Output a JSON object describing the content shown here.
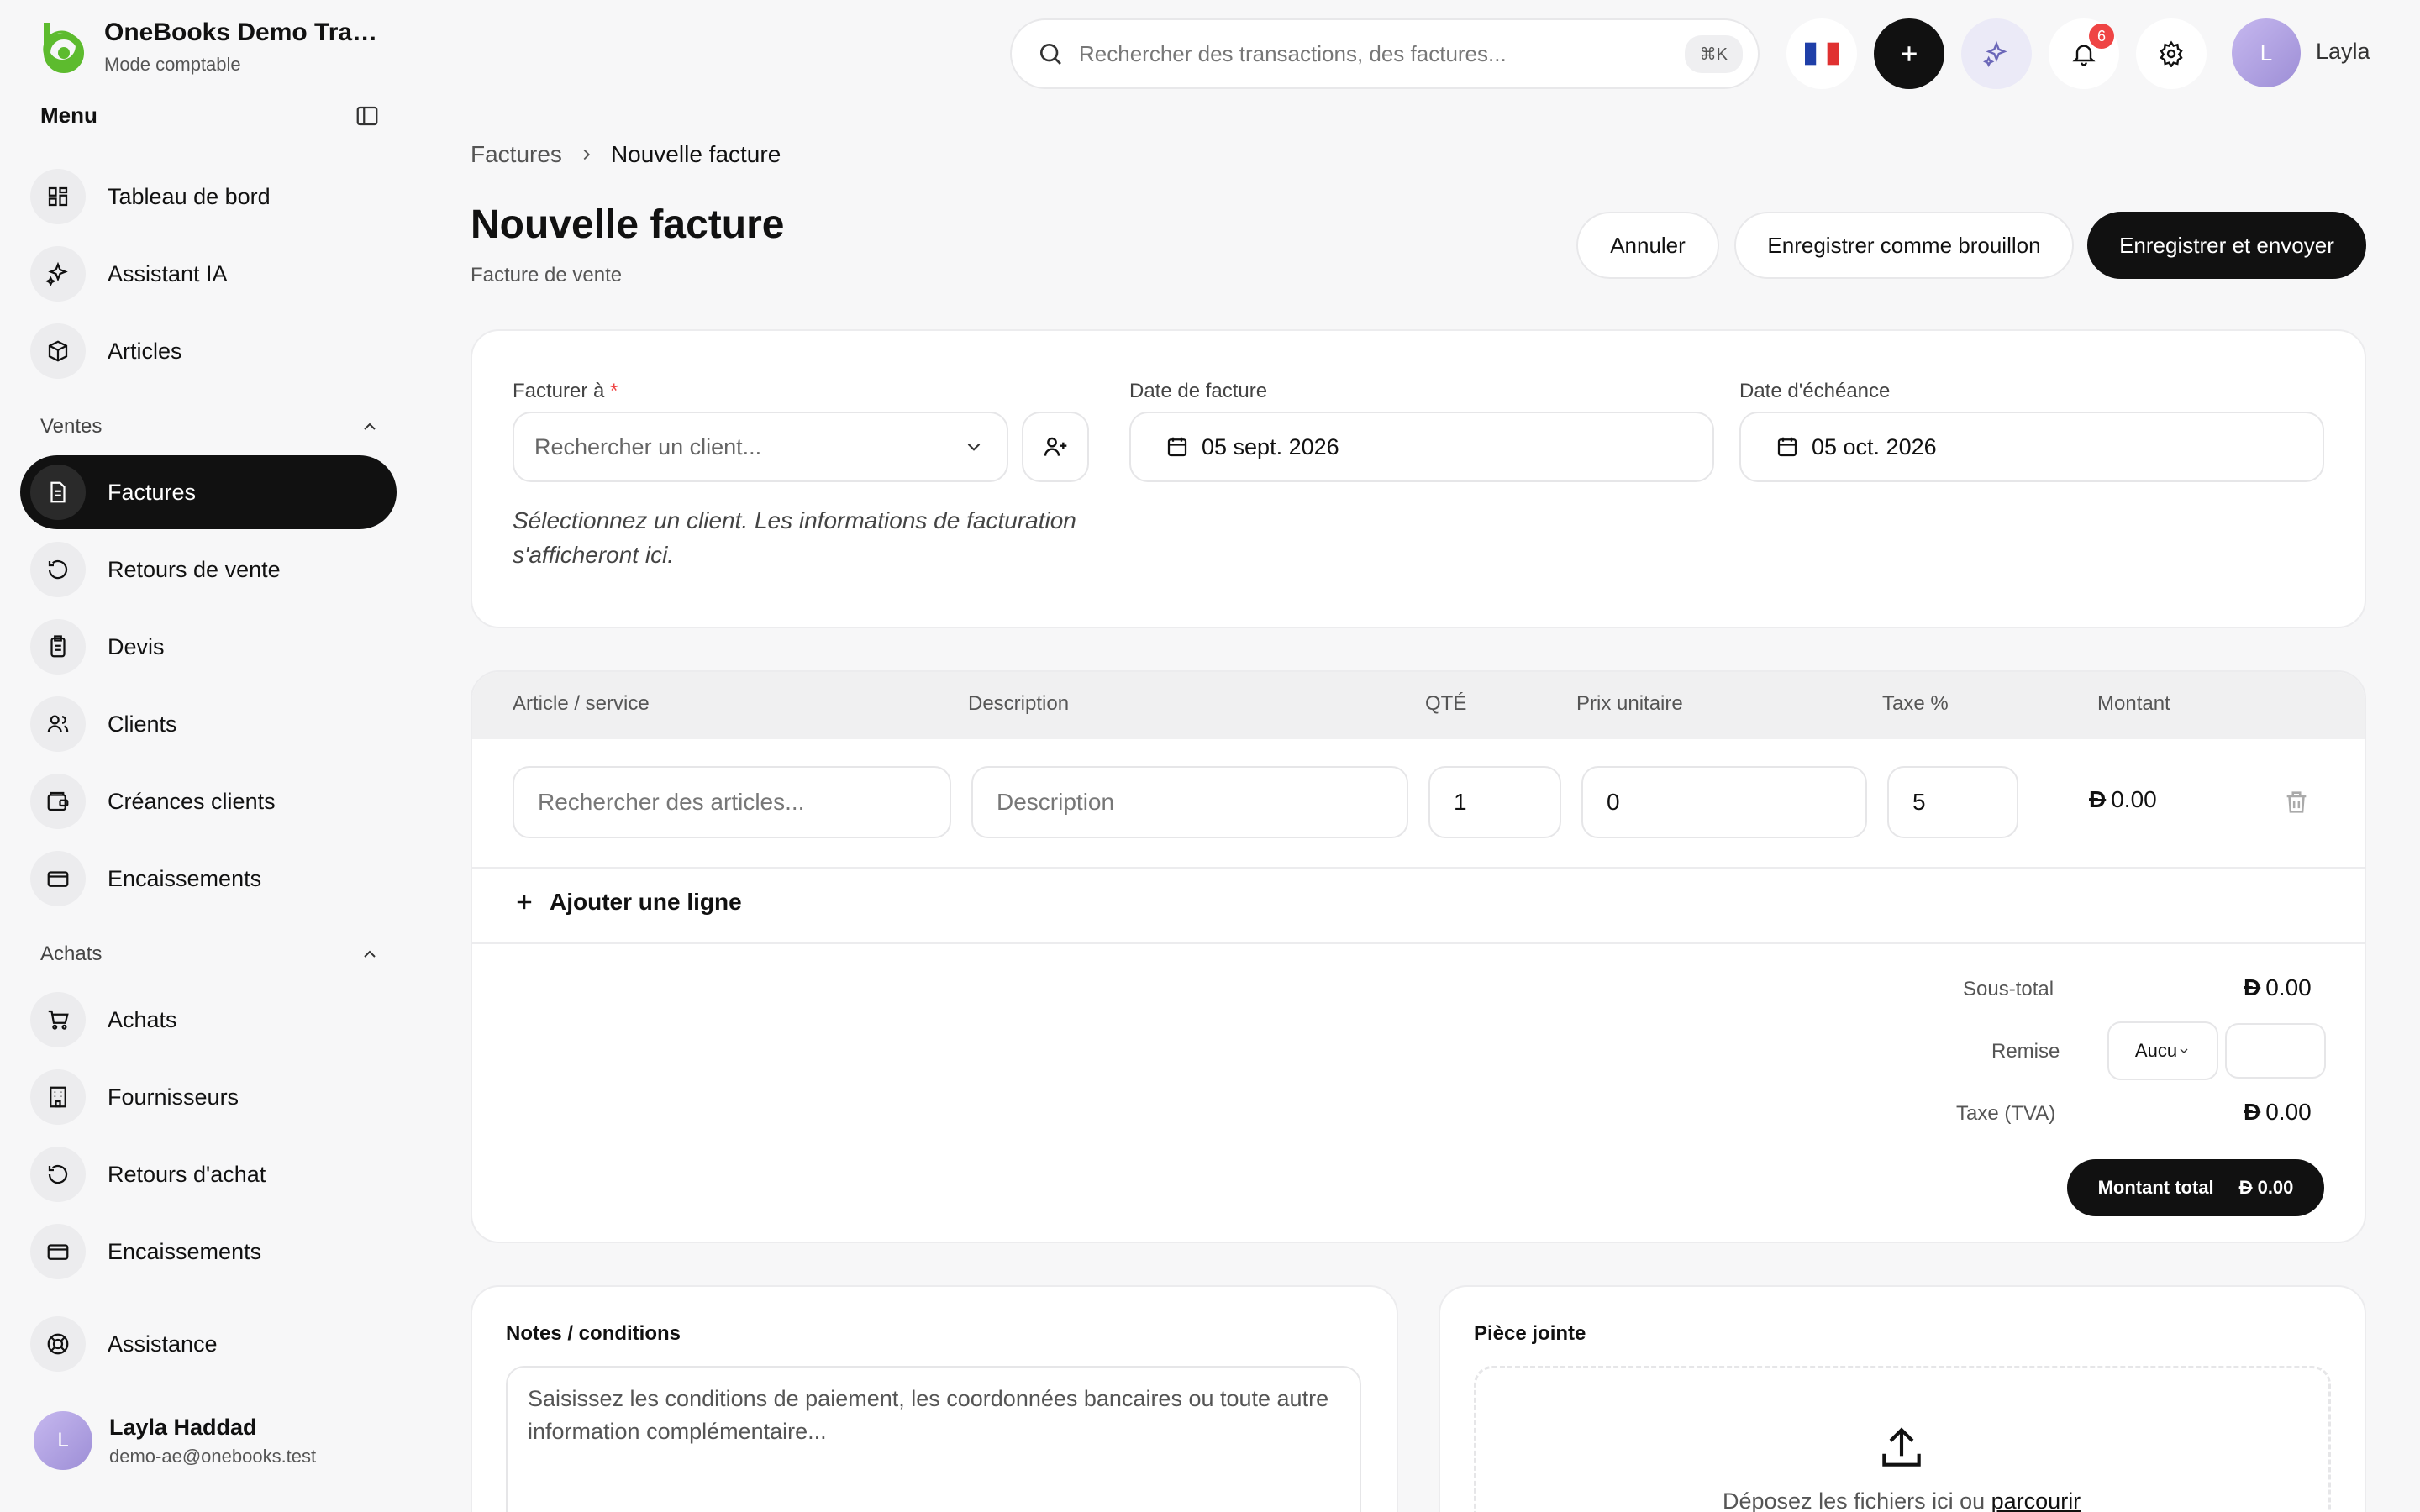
{
  "brand": {
    "name": "OneBooks Demo Tradin...",
    "mode": "Mode comptable"
  },
  "menu": {
    "title": "Menu"
  },
  "sidebar": {
    "top_items": [
      {
        "label": "Tableau de bord",
        "icon": "dashboard-icon"
      },
      {
        "label": "Assistant IA",
        "icon": "sparkles-icon"
      },
      {
        "label": "Articles",
        "icon": "package-icon"
      }
    ],
    "sales_section": "Ventes",
    "sales_items": [
      {
        "label": "Factures",
        "icon": "invoice-icon",
        "active": true
      },
      {
        "label": "Retours de vente",
        "icon": "rotate-ccw-icon"
      },
      {
        "label": "Devis",
        "icon": "clipboard-icon"
      },
      {
        "label": "Clients",
        "icon": "users-icon"
      },
      {
        "label": "Créances clients",
        "icon": "wallet-icon"
      },
      {
        "label": "Encaissements",
        "icon": "credit-card-icon"
      }
    ],
    "purchases_section": "Achats",
    "purchase_items": [
      {
        "label": "Achats",
        "icon": "cart-icon"
      },
      {
        "label": "Fournisseurs",
        "icon": "building-icon"
      },
      {
        "label": "Retours d'achat",
        "icon": "rotate-ccw-icon"
      },
      {
        "label": "Encaissements",
        "icon": "credit-card-icon"
      }
    ],
    "support": {
      "label": "Assistance",
      "icon": "lifebuoy-icon"
    }
  },
  "user": {
    "initial": "L",
    "name": "Layla Haddad",
    "email": "demo-ae@onebooks.test",
    "short": "Layla"
  },
  "topbar": {
    "search_placeholder": "Rechercher des transactions, des factures...",
    "shortcut": "⌘K",
    "notifications_count": "6"
  },
  "breadcrumb": {
    "parent": "Factures",
    "current": "Nouvelle facture"
  },
  "page": {
    "title": "Nouvelle facture",
    "subtitle": "Facture de vente"
  },
  "actions": {
    "cancel": "Annuler",
    "draft": "Enregistrer comme brouillon",
    "save_send": "Enregistrer et envoyer"
  },
  "invoice": {
    "bill_to_label": "Facturer à",
    "required_mark": "*",
    "client_placeholder": "Rechercher un client...",
    "date_label": "Date de facture",
    "date_value": "05 sept. 2026",
    "due_label": "Date d'échéance",
    "due_value": "05 oct. 2026",
    "hint": "Sélectionnez un client. Les informations de facturation s'afficheront ici."
  },
  "lines": {
    "headers": [
      "Article / service",
      "Description",
      "QTÉ",
      "Prix unitaire",
      "Taxe %",
      "Montant"
    ],
    "row": {
      "article_placeholder": "Rechercher des articles...",
      "description_placeholder": "Description",
      "qty": "1",
      "price": "0",
      "tax": "5",
      "currency": "Đ",
      "amount": "0.00"
    },
    "add_line": "Ajouter une ligne"
  },
  "totals": {
    "currency": "Đ",
    "subtotal_label": "Sous-total",
    "subtotal": "0.00",
    "discount_label": "Remise",
    "discount_type": "Aucu",
    "tax_label": "Taxe (TVA)",
    "tax": "0.00",
    "total_label": "Montant total",
    "total": "0.00"
  },
  "notes": {
    "title": "Notes / conditions",
    "placeholder": "Saisissez les conditions de paiement, les coordonnées bancaires ou toute autre information complémentaire..."
  },
  "attachment": {
    "title": "Pièce jointe",
    "drop_text": "Déposez les fichiers ici ou ",
    "browse": "parcourir"
  },
  "colors": {
    "accent": "#111111",
    "brand_green": "#5dbb2e",
    "danger": "#ef4444"
  }
}
